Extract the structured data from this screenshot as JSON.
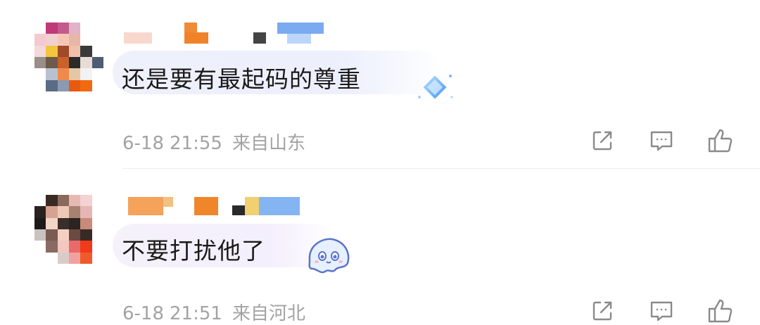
{
  "comments": [
    {
      "username": "",
      "text": "还是要有最起码的尊重",
      "date": "6-18",
      "time": "21:55",
      "location": "来自山东",
      "actions": [
        "share-icon",
        "reply-icon",
        "like-icon"
      ]
    },
    {
      "username": "",
      "text": "不要打扰他了",
      "date": "6-18",
      "time": "21:51",
      "location": "来自河北",
      "actions": [
        "share-icon",
        "reply-icon",
        "like-icon"
      ]
    }
  ],
  "colors": {
    "text": "#1a1a1a",
    "meta": "#a3a3a3",
    "icon": "#8a8a8a",
    "divider": "#ececec"
  }
}
